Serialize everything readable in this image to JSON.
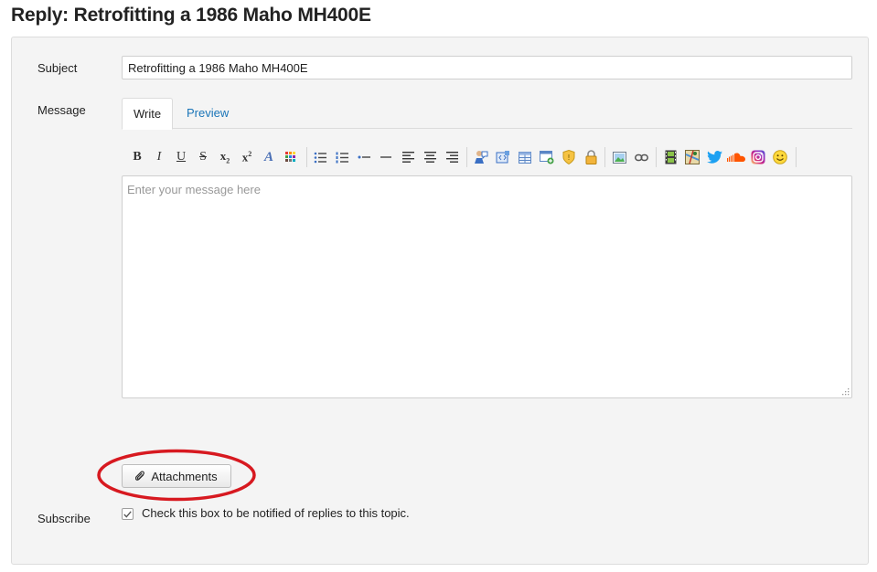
{
  "page": {
    "title": "Reply: Retrofitting a 1986 Maho MH400E"
  },
  "form": {
    "subject_label": "Subject",
    "subject_value": "Retrofitting a 1986 Maho MH400E",
    "message_label": "Message",
    "tabs": [
      {
        "label": "Write",
        "active": true
      },
      {
        "label": "Preview",
        "active": false
      }
    ],
    "message_placeholder": "Enter your message here",
    "attachments_label": "Attachments",
    "subscribe_label": "Subscribe",
    "subscribe_text": "Check this box to be notified of replies to this topic.",
    "subscribe_checked": true
  },
  "toolbar": {
    "bold_glyph": "B",
    "italic_glyph": "I",
    "underline_glyph": "U",
    "strike_glyph": "S",
    "subscript_glyph": "x",
    "superscript_glyph": "x",
    "font_glyph": "A",
    "icons": [
      "bold-icon",
      "italic-icon",
      "underline-icon",
      "strikethrough-icon",
      "subscript-icon",
      "superscript-icon",
      "font-face-icon",
      "color-icon",
      "unordered-list-icon",
      "ordered-list-icon",
      "outdent-icon",
      "horizontal-rule-icon",
      "align-left-icon",
      "align-center-icon",
      "align-right-icon",
      "quote-icon",
      "code-icon",
      "table-icon",
      "hide-icon",
      "spoiler-icon",
      "lock-icon",
      "image-icon",
      "link-icon",
      "video-icon",
      "map-icon",
      "twitter-icon",
      "soundcloud-icon",
      "instagram-icon",
      "smiley-icon"
    ]
  },
  "colors": {
    "accent_link": "#1a75b8",
    "highlight_ring": "#d71920",
    "panel_bg": "#f4f4f4"
  }
}
